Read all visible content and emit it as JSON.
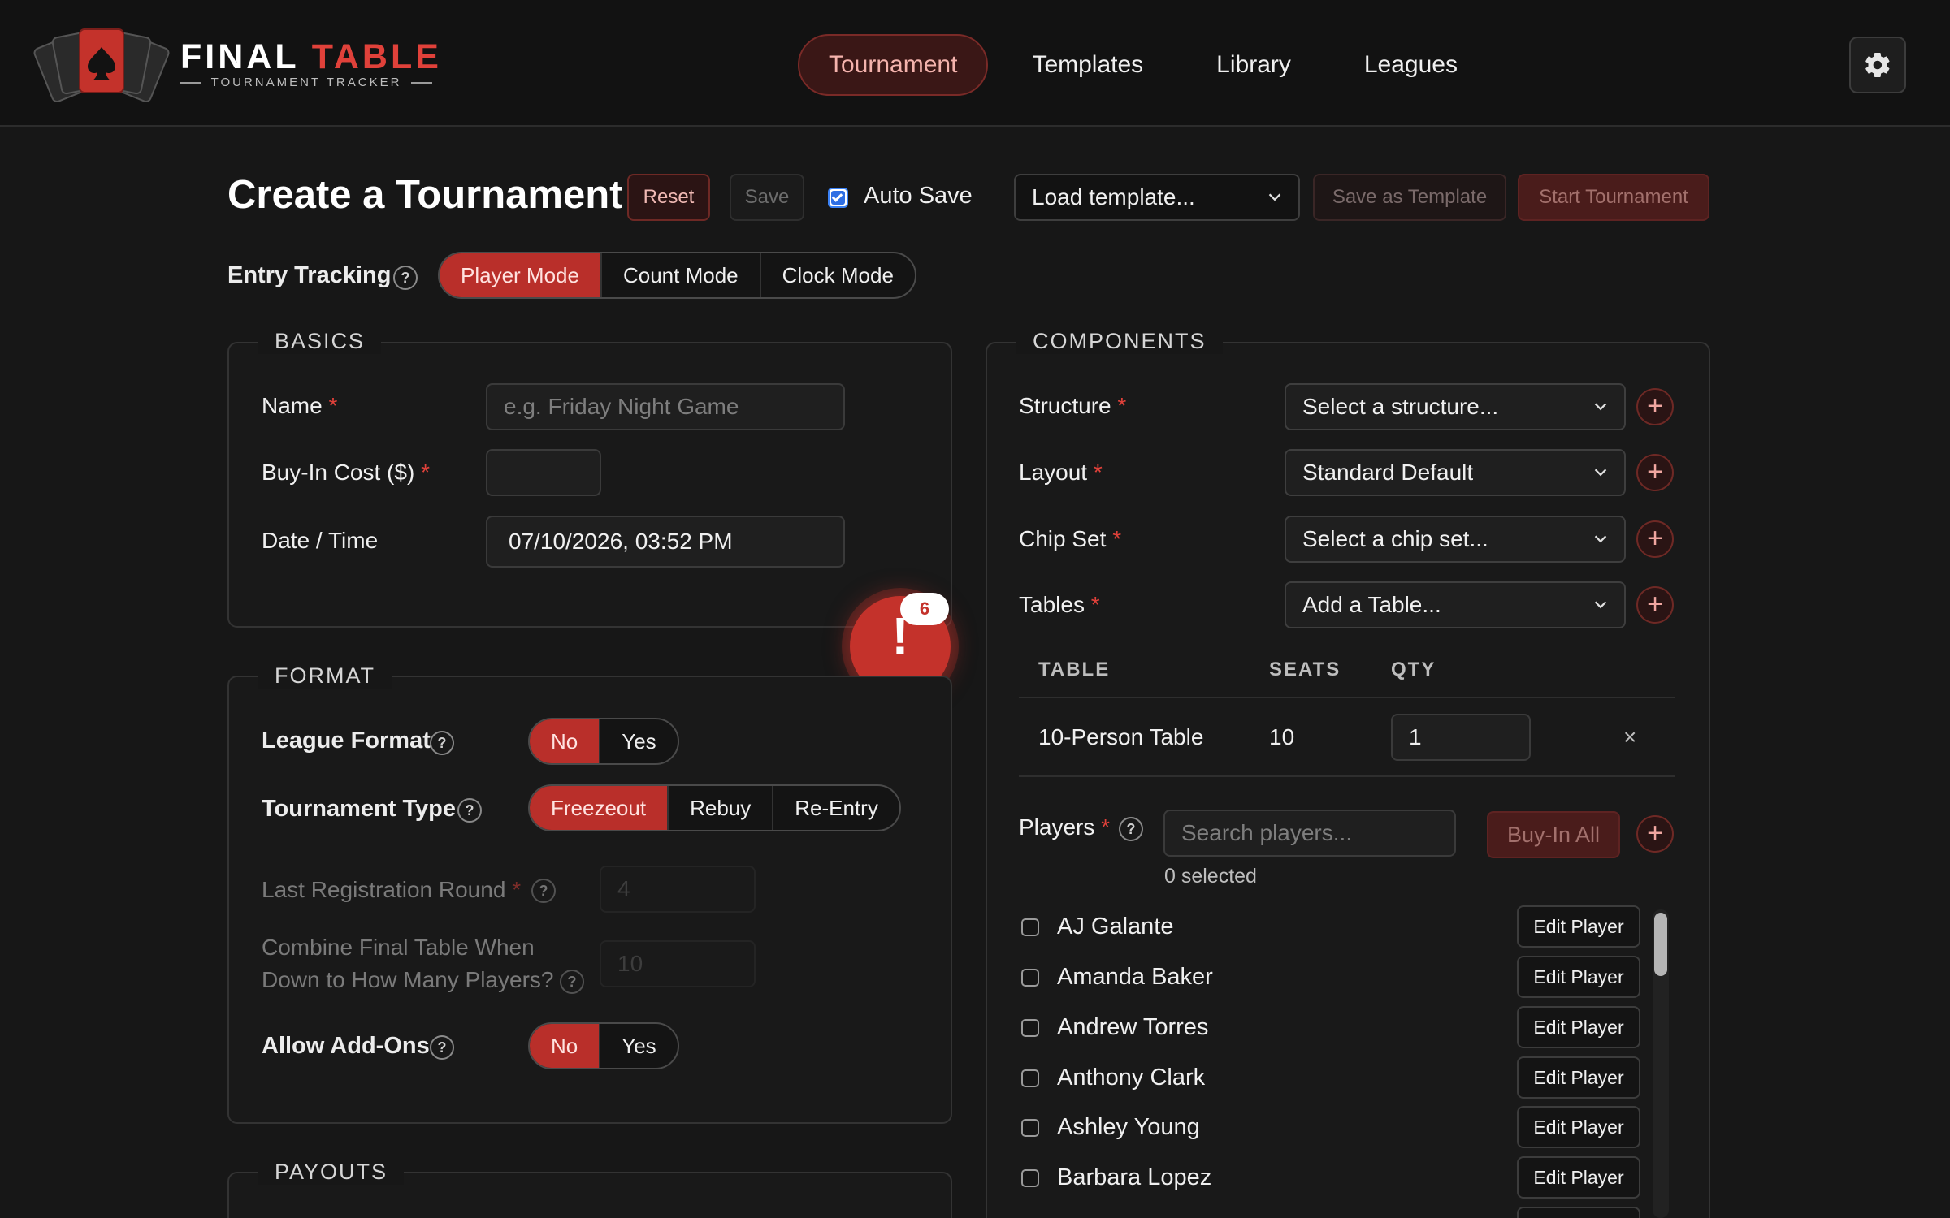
{
  "brand": {
    "name_part1": "FINAL",
    "name_part2": "TABLE",
    "subtitle": "TOURNAMENT TRACKER",
    "accent_color": "#e0413a"
  },
  "nav": {
    "items": [
      {
        "label": "Tournament",
        "active": true
      },
      {
        "label": "Templates",
        "active": false
      },
      {
        "label": "Library",
        "active": false
      },
      {
        "label": "Leagues",
        "active": false
      }
    ],
    "settings_icon": "gear-icon"
  },
  "toolbar": {
    "title": "Create a Tournament",
    "reset_label": "Reset",
    "save_label": "Save",
    "auto_save_label": "Auto Save",
    "auto_save_checked": true,
    "template_select": "Load template...",
    "save_template_label": "Save as Template",
    "start_label": "Start Tournament"
  },
  "entry_tracking": {
    "label": "Entry Tracking",
    "help": "?",
    "options": [
      "Player Mode",
      "Count Mode",
      "Clock Mode"
    ],
    "selected": "Player Mode"
  },
  "basics": {
    "legend": "BASICS",
    "name_label": "Name",
    "name_placeholder": "e.g. Friday Night Game",
    "buyin_label": "Buy-In Cost ($)",
    "buyin_value": "",
    "datetime_label": "Date / Time",
    "datetime_value": "07/10/2026, 03:52 PM",
    "required_mark": "*"
  },
  "alert": {
    "icon": "!",
    "count": "6"
  },
  "format": {
    "legend": "FORMAT",
    "league_format_label": "League Format",
    "league_format_options": [
      "No",
      "Yes"
    ],
    "league_format_selected": "No",
    "tournament_type_label": "Tournament Type",
    "tournament_type_options": [
      "Freezeout",
      "Rebuy",
      "Re-Entry"
    ],
    "tournament_type_selected": "Freezeout",
    "last_reg_label": "Last Registration Round",
    "last_reg_value": "4",
    "combine_label_line1": "Combine Final Table When",
    "combine_label_line2": "Down to How Many Players?",
    "combine_value": "10",
    "addons_label": "Allow Add-Ons",
    "addons_options": [
      "No",
      "Yes"
    ],
    "addons_selected": "No",
    "help": "?"
  },
  "payouts": {
    "legend": "PAYOUTS"
  },
  "components": {
    "legend": "COMPONENTS",
    "structure_label": "Structure",
    "structure_value": "Select a structure...",
    "layout_label": "Layout",
    "layout_value": "Standard Default",
    "chipset_label": "Chip Set",
    "chipset_value": "Select a chip set...",
    "tables_label": "Tables",
    "tables_value": "Add a Table...",
    "plus": "+",
    "table_headers": [
      "TABLE",
      "SEATS",
      "QTY"
    ],
    "table_rows": [
      {
        "table": "10-Person Table",
        "seats": "10",
        "qty": "1",
        "remove": "×"
      }
    ]
  },
  "players": {
    "label": "Players",
    "help": "?",
    "search_placeholder": "Search players...",
    "buyin_all_label": "Buy-In All",
    "selected_count": "0 selected",
    "edit_label": "Edit Player",
    "list": [
      "AJ Galante",
      "Amanda Baker",
      "Andrew Torres",
      "Anthony Clark",
      "Ashley Young",
      "Barbara Lopez"
    ]
  }
}
